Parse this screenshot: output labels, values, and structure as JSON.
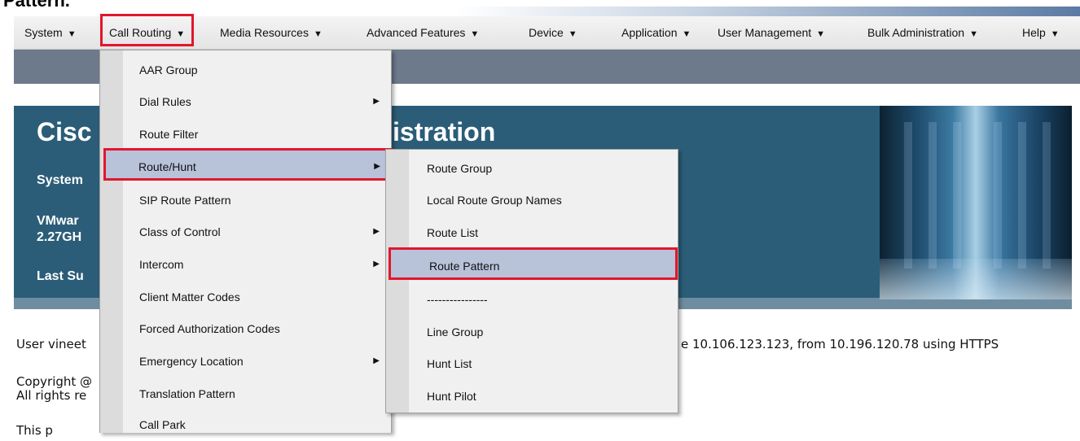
{
  "page": {
    "heading_fragment": "Pattern."
  },
  "menubar": {
    "items": [
      {
        "label": "System"
      },
      {
        "label": "Call Routing"
      },
      {
        "label": "Media Resources"
      },
      {
        "label": "Advanced Features"
      },
      {
        "label": "Device"
      },
      {
        "label": "Application"
      },
      {
        "label": "User Management"
      },
      {
        "label": "Bulk Administration"
      },
      {
        "label": "Help"
      }
    ],
    "caret": "▼"
  },
  "banner": {
    "title_left": "Cisc",
    "title_right": "istration",
    "line1": "System",
    "line2a": "VMwar",
    "line2b": "2.27GH",
    "line3": "Last Su"
  },
  "body": {
    "user_left": "User vineet",
    "user_right": "e 10.106.123.123, from 10.196.120.78 using HTTPS",
    "copyright1": "Copyright @",
    "copyright2": "All rights re",
    "this_line": "This p"
  },
  "call_routing_menu": [
    {
      "label": "AAR Group",
      "submenu": false
    },
    {
      "label": "Dial Rules",
      "submenu": true
    },
    {
      "label": "Route Filter",
      "submenu": false
    },
    {
      "label": "Route/Hunt",
      "submenu": true
    },
    {
      "label": "SIP Route Pattern",
      "submenu": false
    },
    {
      "label": "Class of Control",
      "submenu": true
    },
    {
      "label": "Intercom",
      "submenu": true
    },
    {
      "label": "Client Matter Codes",
      "submenu": false
    },
    {
      "label": "Forced Authorization Codes",
      "submenu": false
    },
    {
      "label": "Emergency Location",
      "submenu": true
    },
    {
      "label": "Translation Pattern",
      "submenu": false
    },
    {
      "label": "Call Park",
      "submenu": false
    }
  ],
  "route_hunt_submenu": [
    {
      "label": "Route Group"
    },
    {
      "label": "Local Route Group Names"
    },
    {
      "label": "Route List"
    },
    {
      "label": "Route Pattern"
    },
    {
      "label": "----------------"
    },
    {
      "label": "Line Group"
    },
    {
      "label": "Hunt List"
    },
    {
      "label": "Hunt Pilot"
    }
  ],
  "colors": {
    "highlight_box": "#e3162b",
    "menu_hover": "#b8c2d9",
    "banner": "#2b5d78",
    "subheader": "#6d7a8c"
  },
  "icons": {
    "submenu_arrow": "▶"
  }
}
